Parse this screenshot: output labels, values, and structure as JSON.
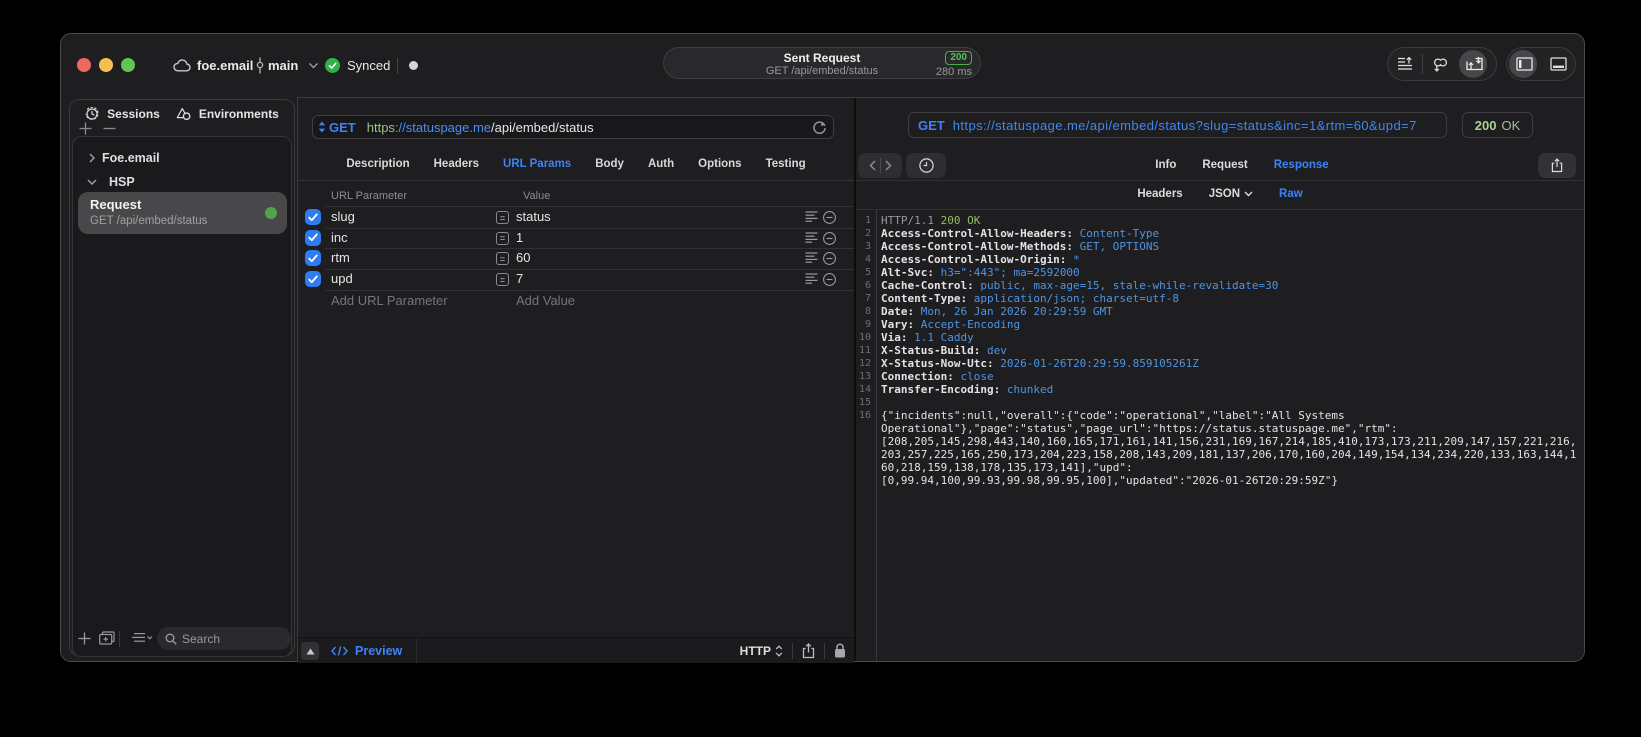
{
  "colors": {
    "accent_blue": "#3d83f8",
    "method_blue": "#3c82f8",
    "status_green": "#53c354",
    "response_green": "#97bc60",
    "header_value_blue": "#4e94e4",
    "checkbox_blue": "#2e7cf2"
  },
  "titlebar": {
    "project": "foe.email",
    "branch": "main",
    "sync_label": "Synced",
    "center": {
      "title": "Sent Request",
      "subtitle": "GET /api/embed/status",
      "status_code": "200",
      "duration": "280 ms"
    }
  },
  "sidebar": {
    "tabs": [
      {
        "label": "Sessions",
        "icon": "history-icon"
      },
      {
        "label": "Environments",
        "icon": "environments-icon"
      }
    ],
    "tree": [
      {
        "label": "Foe.email",
        "expanded": false
      },
      {
        "label": "HSP",
        "expanded": true
      }
    ],
    "selected_request": {
      "name": "Request",
      "method_path": "GET /api/embed/status"
    },
    "search_placeholder": "Search"
  },
  "request_pane": {
    "method": "GET",
    "url_scheme": "https",
    "url_host": "://statuspage.me",
    "url_path": "/api/embed/status",
    "tabs": [
      "Description",
      "Headers",
      "URL Params",
      "Body",
      "Auth",
      "Options",
      "Testing"
    ],
    "active_tab": "URL Params",
    "param_table": {
      "col_key": "URL Parameter",
      "col_value": "Value",
      "rows": [
        {
          "key": "slug",
          "value": "status",
          "enabled": true
        },
        {
          "key": "inc",
          "value": "1",
          "enabled": true
        },
        {
          "key": "rtm",
          "value": "60",
          "enabled": true
        },
        {
          "key": "upd",
          "value": "7",
          "enabled": true
        }
      ],
      "add_key_label": "Add URL Parameter",
      "add_value_label": "Add Value"
    },
    "footer": {
      "preview_label": "Preview",
      "protocol": "HTTP"
    }
  },
  "response_pane": {
    "method": "GET",
    "url": "https://statuspage.me/api/embed/status?slug=status&inc=1&rtm=60&upd=7",
    "status_code": "200",
    "status_text": "OK",
    "tabs": [
      "Info",
      "Request",
      "Response"
    ],
    "active_tab": "Response",
    "subtabs": [
      "Headers",
      "JSON",
      "Raw"
    ],
    "active_subtab": "Raw",
    "body_lines": [
      {
        "n": "1",
        "segs": [
          [
            "HTTP/1.1 ",
            "dim"
          ],
          [
            "200 OK",
            "grn"
          ]
        ]
      },
      {
        "n": "2",
        "segs": [
          [
            "Access-Control-Allow-Headers:",
            "hn"
          ],
          [
            " Content-Type",
            "hv"
          ]
        ]
      },
      {
        "n": "3",
        "segs": [
          [
            "Access-Control-Allow-Methods:",
            "hn"
          ],
          [
            " GET, OPTIONS",
            "hv"
          ]
        ]
      },
      {
        "n": "4",
        "segs": [
          [
            "Access-Control-Allow-Origin:",
            "hn"
          ],
          [
            " *",
            "hv"
          ]
        ]
      },
      {
        "n": "5",
        "segs": [
          [
            "Alt-Svc:",
            "hn"
          ],
          [
            " h3=\":443\"; ma=2592000",
            "hv"
          ]
        ]
      },
      {
        "n": "6",
        "segs": [
          [
            "Cache-Control:",
            "hn"
          ],
          [
            " public, max-age=15, stale-while-revalidate=30",
            "hv"
          ]
        ]
      },
      {
        "n": "7",
        "segs": [
          [
            "Content-Type:",
            "hn"
          ],
          [
            " application/json; charset=utf-8",
            "hv"
          ]
        ]
      },
      {
        "n": "8",
        "segs": [
          [
            "Date:",
            "hn"
          ],
          [
            " Mon, 26 Jan 2026 20:29:59 GMT",
            "hv"
          ]
        ]
      },
      {
        "n": "9",
        "segs": [
          [
            "Vary:",
            "hn"
          ],
          [
            " Accept-Encoding",
            "hv"
          ]
        ]
      },
      {
        "n": "10",
        "segs": [
          [
            "Via:",
            "hn"
          ],
          [
            " 1.1 Caddy",
            "hv"
          ]
        ]
      },
      {
        "n": "11",
        "segs": [
          [
            "X-Status-Build:",
            "hn"
          ],
          [
            " dev",
            "hv"
          ]
        ]
      },
      {
        "n": "12",
        "segs": [
          [
            "X-Status-Now-Utc:",
            "hn"
          ],
          [
            " 2026-01-26T20:29:59.859105261Z",
            "hv"
          ]
        ]
      },
      {
        "n": "13",
        "segs": [
          [
            "Connection:",
            "hn"
          ],
          [
            " close",
            "hv"
          ]
        ]
      },
      {
        "n": "14",
        "segs": [
          [
            "Transfer-Encoding:",
            "hn"
          ],
          [
            " chunked",
            "hv"
          ]
        ]
      },
      {
        "n": "15",
        "segs": []
      },
      {
        "n": "16",
        "segs": [
          [
            "{\"incidents\":null,\"overall\":{\"code\":\"operational\",\"label\":\"All Systems",
            "body"
          ]
        ]
      },
      {
        "n": "",
        "segs": [
          [
            "Operational\"},\"page\":\"status\",\"page_url\":\"https://status.statuspage.me\",\"rtm\":",
            "body"
          ]
        ]
      },
      {
        "n": "",
        "segs": [
          [
            "[208,205,145,298,443,140,160,165,171,161,141,156,231,169,167,214,185,410,173,173,211,209,147,157,221,216,",
            "body"
          ]
        ]
      },
      {
        "n": "",
        "segs": [
          [
            "203,257,225,165,250,173,204,223,158,208,143,209,181,137,206,170,160,204,149,154,134,234,220,133,163,144,1",
            "body"
          ]
        ]
      },
      {
        "n": "",
        "segs": [
          [
            "60,218,159,138,178,135,173,141],\"upd\":",
            "body"
          ]
        ]
      },
      {
        "n": "",
        "segs": [
          [
            "[0,99.94,100,99.93,99.98,99.95,100],\"updated\":\"2026-01-26T20:29:59Z\"}",
            "body"
          ]
        ]
      }
    ]
  }
}
